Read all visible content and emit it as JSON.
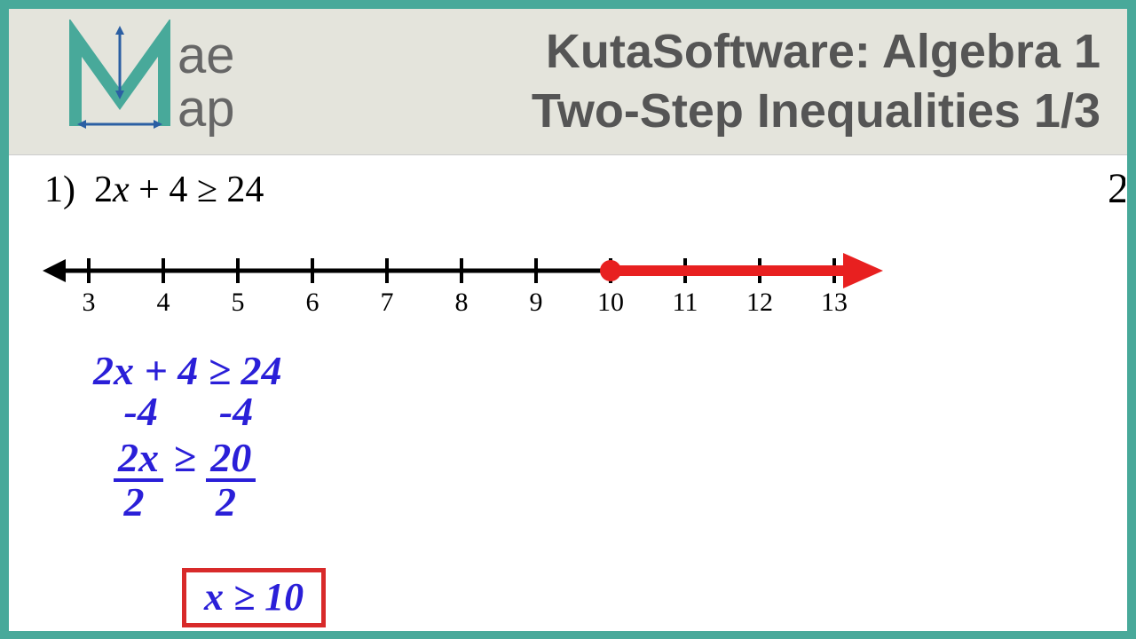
{
  "header": {
    "logo_text_line1": "ae",
    "logo_text_line2": "ap",
    "title_line1": "KutaSoftware: Algebra 1",
    "title_line2": "Two-Step Inequalities 1/3"
  },
  "problem": {
    "number": "1)",
    "expression": "2x + 4 ≥ 24"
  },
  "numberline": {
    "ticks": [
      "3",
      "4",
      "5",
      "6",
      "7",
      "8",
      "9",
      "10",
      "11",
      "12",
      "13"
    ],
    "solution_start": 10,
    "closed_circle": true,
    "ray_direction": "right"
  },
  "work": {
    "step1": "2x + 4 ≥ 24",
    "step2_left": "-4",
    "step2_right": "-4",
    "step3_left_num": "2x",
    "step3_left_den": "2",
    "step3_op": "≥",
    "step3_right_num": "20",
    "step3_right_den": "2"
  },
  "answer": "x ≥ 10",
  "right_cut": "2"
}
